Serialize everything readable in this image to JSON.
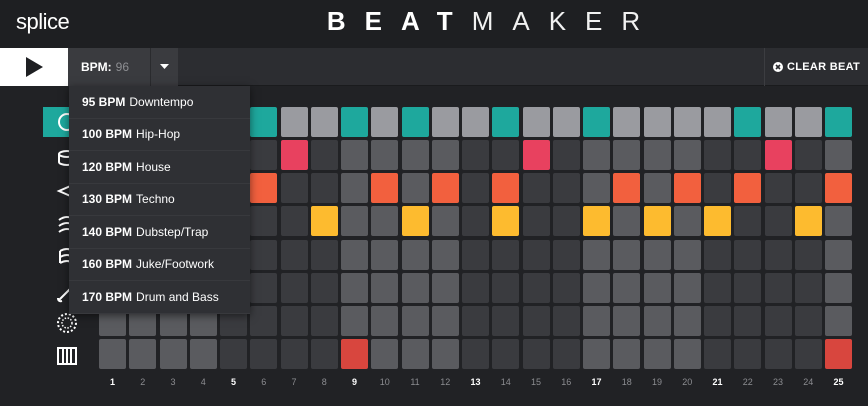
{
  "header": {
    "logo": "splice",
    "title_bold": "BEAT",
    "title_light": "MAKER"
  },
  "toolbar": {
    "bpm_label": "BPM:",
    "bpm_value": "96",
    "clear_label": "CLEAR BEAT"
  },
  "bpm_options": [
    {
      "bpm": "95 BPM",
      "genre": "Downtempo"
    },
    {
      "bpm": "100 BPM",
      "genre": "Hip-Hop"
    },
    {
      "bpm": "120 BPM",
      "genre": "House"
    },
    {
      "bpm": "130 BPM",
      "genre": "Techno"
    },
    {
      "bpm": "140 BPM",
      "genre": "Dubstep/Trap"
    },
    {
      "bpm": "160 BPM",
      "genre": "Juke/Footwork"
    },
    {
      "bpm": "170 BPM",
      "genre": "Drum and Bass"
    }
  ],
  "instruments": [
    "cymbal-icon",
    "snare-icon",
    "hihat-icon",
    "clap-icon",
    "tom-icon",
    "shaker-icon",
    "tambourine-icon",
    "keys-icon"
  ],
  "colors": {
    "teal": "#1ea89d",
    "pink": "#e8415f",
    "orange": "#f2603e",
    "yellow": "#fdbb2f",
    "red": "#d8463e",
    "beat_light": "#5a5b5f",
    "beat_dark": "#3a3b3f"
  },
  "steps": [
    "1",
    "2",
    "3",
    "4",
    "5",
    "6",
    "7",
    "8",
    "9",
    "10",
    "11",
    "12",
    "13",
    "14",
    "15",
    "16",
    "17",
    "18",
    "19",
    "20",
    "21",
    "22",
    "23",
    "24",
    "25"
  ],
  "pattern": {
    "row0": {
      "color": "teal",
      "on": [
        6,
        9,
        11,
        14,
        17,
        22,
        25
      ]
    },
    "row1": {
      "color": "pink",
      "on": [
        7,
        15,
        23
      ]
    },
    "row2": {
      "color": "orange",
      "on": [
        6,
        10,
        12,
        14,
        18,
        20,
        22,
        25
      ]
    },
    "row3": {
      "color": "yellow",
      "on": [
        8,
        11,
        14,
        17,
        19,
        21,
        24
      ]
    },
    "row4": {
      "color": "teal",
      "on": []
    },
    "row5": {
      "color": "teal",
      "on": []
    },
    "row6": {
      "color": "teal",
      "on": []
    },
    "row7": {
      "color": "red",
      "on": [
        9,
        25
      ]
    }
  }
}
